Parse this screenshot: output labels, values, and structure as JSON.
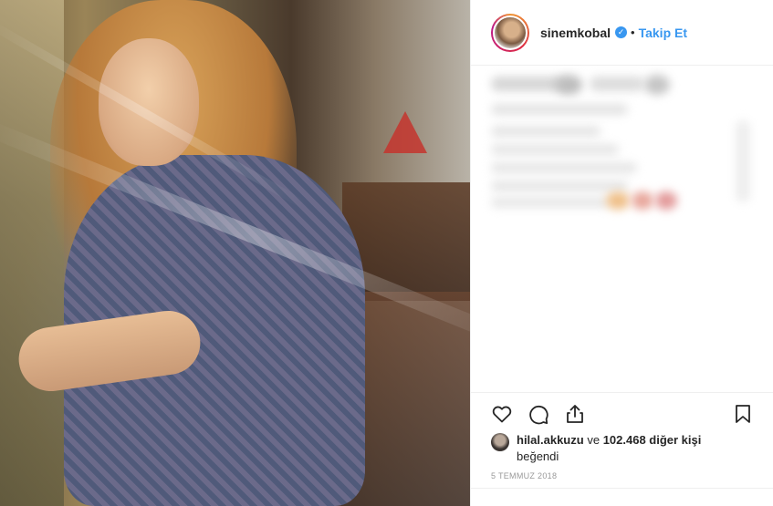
{
  "post": {
    "username": "sinemkobal",
    "verified_icon": "verified-badge-icon",
    "separator": "•",
    "follow_label": "Takip Et",
    "likes": {
      "liker": "hilal.akkuzu",
      "connector": "ve",
      "count_text": "102.468 diğer kişi",
      "suffix": "beğendi"
    },
    "date": "5 TEMMUZ 2018",
    "icons": {
      "like": "heart-icon",
      "comment": "comment-icon",
      "share": "share-icon",
      "save": "bookmark-icon"
    },
    "colors": {
      "link": "#3897f0",
      "text": "#262626",
      "muted": "#999999",
      "divider": "#efefef"
    }
  }
}
